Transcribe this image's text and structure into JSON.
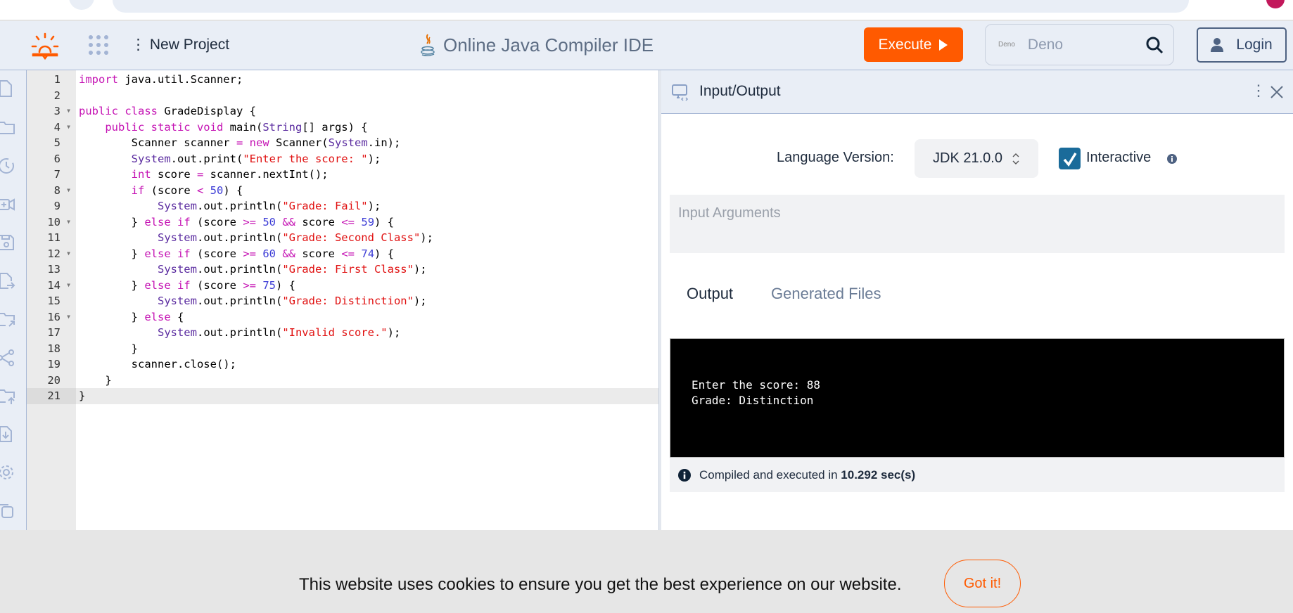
{
  "header": {
    "new_project": "New Project",
    "title": "Online Java Compiler IDE",
    "execute_label": "Execute",
    "search_logo_text": "Deno",
    "search_placeholder": "Deno",
    "login_label": "Login"
  },
  "sidebar": {
    "icons": [
      "new-file-icon",
      "folder-icon",
      "history-icon",
      "add-video-icon",
      "save-icon",
      "file-export-icon",
      "folder-share-icon",
      "share-icon",
      "folder-upload-icon",
      "download-file-icon",
      "settings-icon",
      "copy-icon"
    ]
  },
  "editor": {
    "active_line": 21,
    "folds": [
      3,
      4,
      8,
      10,
      12,
      14,
      16
    ],
    "lines": [
      [
        [
          "kw",
          "import"
        ],
        [
          "plain",
          " java.util.Scanner;"
        ]
      ],
      [],
      [
        [
          "kw",
          "public class"
        ],
        [
          "plain",
          " GradeDisplay {"
        ]
      ],
      [
        [
          "plain",
          "    "
        ],
        [
          "kw",
          "public static void"
        ],
        [
          "plain",
          " main("
        ],
        [
          "type",
          "String"
        ],
        [
          "plain",
          "[] args) {"
        ]
      ],
      [
        [
          "plain",
          "        Scanner scanner "
        ],
        [
          "op",
          "="
        ],
        [
          "plain",
          " "
        ],
        [
          "kw",
          "new"
        ],
        [
          "plain",
          " Scanner("
        ],
        [
          "type",
          "System"
        ],
        [
          "plain",
          ".in);"
        ]
      ],
      [
        [
          "plain",
          "        "
        ],
        [
          "type",
          "System"
        ],
        [
          "plain",
          ".out.print("
        ],
        [
          "str",
          "\"Enter the score: \""
        ],
        [
          "plain",
          ");"
        ]
      ],
      [
        [
          "plain",
          "        "
        ],
        [
          "kw",
          "int"
        ],
        [
          "plain",
          " score "
        ],
        [
          "op",
          "="
        ],
        [
          "plain",
          " scanner.nextInt();"
        ]
      ],
      [
        [
          "plain",
          "        "
        ],
        [
          "kw",
          "if"
        ],
        [
          "plain",
          " (score "
        ],
        [
          "op",
          "<"
        ],
        [
          "plain",
          " "
        ],
        [
          "num",
          "50"
        ],
        [
          "plain",
          ") {"
        ]
      ],
      [
        [
          "plain",
          "            "
        ],
        [
          "type",
          "System"
        ],
        [
          "plain",
          ".out.println("
        ],
        [
          "str",
          "\"Grade: Fail\""
        ],
        [
          "plain",
          ");"
        ]
      ],
      [
        [
          "plain",
          "        } "
        ],
        [
          "kw",
          "else if"
        ],
        [
          "plain",
          " (score "
        ],
        [
          "op",
          ">="
        ],
        [
          "plain",
          " "
        ],
        [
          "num",
          "50"
        ],
        [
          "plain",
          " "
        ],
        [
          "op",
          "&&"
        ],
        [
          "plain",
          " score "
        ],
        [
          "op",
          "<="
        ],
        [
          "plain",
          " "
        ],
        [
          "num",
          "59"
        ],
        [
          "plain",
          ") {"
        ]
      ],
      [
        [
          "plain",
          "            "
        ],
        [
          "type",
          "System"
        ],
        [
          "plain",
          ".out.println("
        ],
        [
          "str",
          "\"Grade: Second Class\""
        ],
        [
          "plain",
          ");"
        ]
      ],
      [
        [
          "plain",
          "        } "
        ],
        [
          "kw",
          "else if"
        ],
        [
          "plain",
          " (score "
        ],
        [
          "op",
          ">="
        ],
        [
          "plain",
          " "
        ],
        [
          "num",
          "60"
        ],
        [
          "plain",
          " "
        ],
        [
          "op",
          "&&"
        ],
        [
          "plain",
          " score "
        ],
        [
          "op",
          "<="
        ],
        [
          "plain",
          " "
        ],
        [
          "num",
          "74"
        ],
        [
          "plain",
          ") {"
        ]
      ],
      [
        [
          "plain",
          "            "
        ],
        [
          "type",
          "System"
        ],
        [
          "plain",
          ".out.println("
        ],
        [
          "str",
          "\"Grade: First Class\""
        ],
        [
          "plain",
          ");"
        ]
      ],
      [
        [
          "plain",
          "        } "
        ],
        [
          "kw",
          "else if"
        ],
        [
          "plain",
          " (score "
        ],
        [
          "op",
          ">="
        ],
        [
          "plain",
          " "
        ],
        [
          "num",
          "75"
        ],
        [
          "plain",
          ") {"
        ]
      ],
      [
        [
          "plain",
          "            "
        ],
        [
          "type",
          "System"
        ],
        [
          "plain",
          ".out.println("
        ],
        [
          "str",
          "\"Grade: Distinction\""
        ],
        [
          "plain",
          ");"
        ]
      ],
      [
        [
          "plain",
          "        } "
        ],
        [
          "kw",
          "else"
        ],
        [
          "plain",
          " {"
        ]
      ],
      [
        [
          "plain",
          "            "
        ],
        [
          "type",
          "System"
        ],
        [
          "plain",
          ".out.println("
        ],
        [
          "str",
          "\"Invalid score.\""
        ],
        [
          "plain",
          ");"
        ]
      ],
      [
        [
          "plain",
          "        }"
        ]
      ],
      [
        [
          "plain",
          "        scanner.close();"
        ]
      ],
      [
        [
          "plain",
          "    }"
        ]
      ],
      [
        [
          "plain",
          "}"
        ]
      ]
    ]
  },
  "io": {
    "title": "Input/Output",
    "language_label": "Language Version:",
    "language_value": "JDK 21.0.0",
    "interactive_label": "Interactive",
    "interactive_checked": true,
    "args_placeholder": "Input Arguments",
    "tabs": [
      "Output",
      "Generated Files"
    ],
    "console_output": "Enter the score: 88\nGrade: Distinction",
    "status_prefix": "Compiled and executed in ",
    "status_time": "10.292 sec(s)"
  },
  "cookie": {
    "message": "This website uses cookies to ensure you get the best experience on our website.",
    "button": "Got it!"
  },
  "colors": {
    "accent": "#ff5a00",
    "header_bg": "#e9eef6",
    "checkbox": "#1a6b9a"
  }
}
